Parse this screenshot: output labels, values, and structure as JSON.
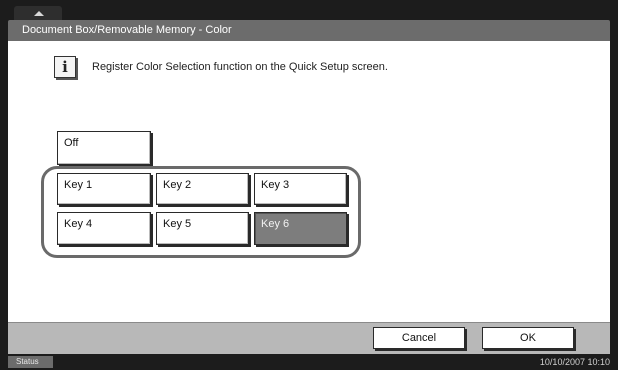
{
  "window": {
    "title": "Document Box/Removable Memory - Color"
  },
  "info": {
    "icon": "info-icon",
    "glyph": "i",
    "message": "Register Color Selection function on the Quick Setup screen."
  },
  "options": {
    "off": "Off",
    "keys": [
      "Key 1",
      "Key 2",
      "Key 3",
      "Key 4",
      "Key 5",
      "Key 6"
    ],
    "selected": "Key 6"
  },
  "footer": {
    "cancel_label": "Cancel",
    "ok_label": "OK"
  },
  "status": {
    "label": "Status",
    "datetime": "10/10/2007   10:10"
  },
  "colors": {
    "titlebar": "#6c6c6c",
    "selected_button": "#7d7d7d",
    "footer": "#b8b8b8"
  }
}
